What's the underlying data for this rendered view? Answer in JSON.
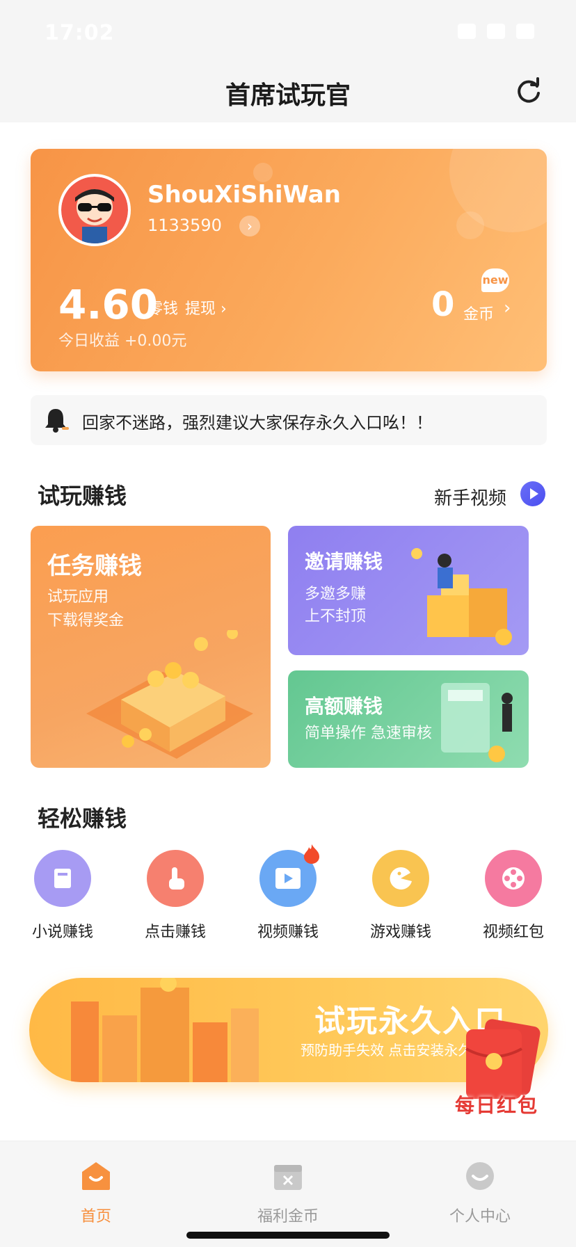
{
  "status_bar": {
    "time": "17:02"
  },
  "header": {
    "title": "首席试玩官",
    "refresh_icon": "refresh-icon"
  },
  "profile": {
    "username": "ShouXiShiWan",
    "user_id": "1133590",
    "balance": "4.60",
    "balance_label": "零钱",
    "withdraw_label": "提现",
    "today_income": "今日收益 +0.00元",
    "coins": "0",
    "coins_label": "金币",
    "new_badge": "new"
  },
  "notice": {
    "text": "回家不迷路，强烈建议大家保存永久入口吆！！"
  },
  "section_trial": {
    "title": "试玩赚钱",
    "video_link": "新手视频"
  },
  "tasks": {
    "main": {
      "title": "任务赚钱",
      "line1": "试玩应用",
      "line2": "下载得奖金"
    },
    "invite": {
      "title": "邀请赚钱",
      "line1": "多邀多赚",
      "line2": "上不封顶"
    },
    "high": {
      "title": "高额赚钱",
      "line1": "简单操作 急速审核"
    }
  },
  "section_easy": {
    "title": "轻松赚钱"
  },
  "easy_items": [
    {
      "label": "小说赚钱",
      "color": "#a79bf3",
      "icon": "book-icon"
    },
    {
      "label": "点击赚钱",
      "color": "#f6806f",
      "icon": "tap-icon"
    },
    {
      "label": "视频赚钱",
      "color": "#6aa8f4",
      "icon": "video-icon"
    },
    {
      "label": "游戏赚钱",
      "color": "#f9c451",
      "icon": "game-icon"
    },
    {
      "label": "视频红包",
      "color": "#f57aa0",
      "icon": "film-reel-icon"
    }
  ],
  "banner": {
    "title": "试玩永久入口",
    "subtitle": "预防助手失效 点击安装永久"
  },
  "daily_redpacket": {
    "label": "每日红包"
  },
  "tabbar": {
    "home": "首页",
    "welfare": "福利金币",
    "profile": "个人中心"
  },
  "colors": {
    "accent": "#f78f3d"
  }
}
